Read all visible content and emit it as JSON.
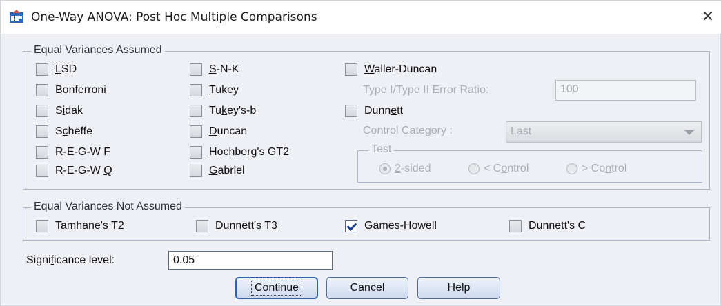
{
  "window": {
    "title": "One-Way ANOVA: Post Hoc Multiple Comparisons",
    "close_icon": "close-icon"
  },
  "equal_assumed": {
    "legend": "Equal Variances Assumed",
    "col1": [
      {
        "pre": "",
        "u": "L",
        "post": "SD",
        "checked": false
      },
      {
        "pre": "",
        "u": "B",
        "post": "onferroni",
        "checked": false
      },
      {
        "pre": "S",
        "u": "i",
        "post": "dak",
        "checked": false
      },
      {
        "pre": "S",
        "u": "c",
        "post": "heffe",
        "checked": false
      },
      {
        "pre": "",
        "u": "R",
        "post": "-E-G-W F",
        "checked": false
      },
      {
        "pre": "R-E-G-W ",
        "u": "Q",
        "post": "",
        "checked": false
      }
    ],
    "col2": [
      {
        "pre": "",
        "u": "S",
        "post": "-N-K",
        "checked": false
      },
      {
        "pre": "",
        "u": "T",
        "post": "ukey",
        "checked": false
      },
      {
        "pre": "Tu",
        "u": "k",
        "post": "ey's-b",
        "checked": false
      },
      {
        "pre": "",
        "u": "D",
        "post": "uncan",
        "checked": false
      },
      {
        "pre": "",
        "u": "H",
        "post": "ochberg's GT2",
        "checked": false
      },
      {
        "pre": "",
        "u": "G",
        "post": "abriel",
        "checked": false
      }
    ],
    "waller": {
      "pre": "",
      "u": "W",
      "post": "aller-Duncan",
      "checked": false
    },
    "error_ratio_label": "Type I/Type II Error Ratio:",
    "error_ratio_value": "100",
    "dunnett": {
      "pre": "Dunn",
      "u": "e",
      "post": "tt",
      "checked": false
    },
    "control_category_label": "Control Category :",
    "control_category_value": "Last",
    "test": {
      "legend": "Test",
      "options": [
        {
          "pre": "",
          "u": "2",
          "post": "-sided",
          "selected": true
        },
        {
          "pre": "< C",
          "u": "o",
          "post": "ntrol",
          "selected": false
        },
        {
          "pre": "> Co",
          "u": "n",
          "post": "trol",
          "selected": false
        }
      ]
    }
  },
  "not_assumed": {
    "legend": "Equal Variances Not Assumed",
    "items": [
      {
        "pre": "Ta",
        "u": "m",
        "post": "hane's T2",
        "checked": false
      },
      {
        "pre": "Dunnett's T",
        "u": "3",
        "post": "",
        "checked": false
      },
      {
        "pre": "G",
        "u": "a",
        "post": "mes-Howell",
        "checked": true
      },
      {
        "pre": "D",
        "u": "u",
        "post": "nnett's C",
        "checked": false
      }
    ]
  },
  "significance": {
    "pre": "Signi",
    "u": "f",
    "post": "icance level:",
    "value": "0.05"
  },
  "buttons": {
    "continue": {
      "pre": "",
      "u": "C",
      "post": "ontinue"
    },
    "cancel": "Cancel",
    "help": "Help"
  }
}
